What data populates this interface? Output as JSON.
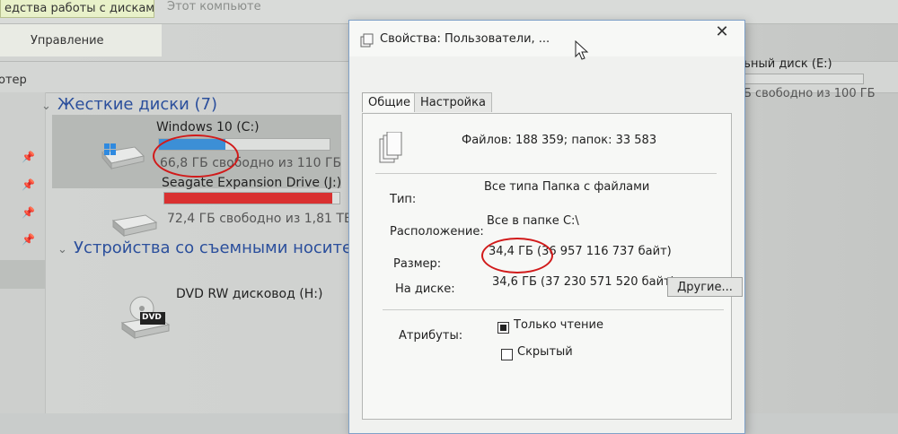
{
  "ribbon": {
    "active_tab": "едства работы с дисками",
    "other_tab": "Этот компьюте",
    "manage_label": "Управление"
  },
  "address": {
    "text": "отер"
  },
  "groups": {
    "hard_drives": "Жесткие диски (7)",
    "removable": "Устройства со съемными носителями"
  },
  "drives": [
    {
      "name": "Windows 10 (C:)",
      "free": "66,8 ГБ свободно из 110 ГБ",
      "used_fraction": 0.39,
      "bar_color": "#3c8fd6"
    },
    {
      "name": "Seagate Expansion Drive (J:)",
      "free": "72,4 ГБ свободно из 1,81 ТБ",
      "used_fraction": 0.96,
      "bar_color": "#d93030"
    },
    {
      "name": "DVD RW дисковод (H:)",
      "icon_text": "DVD"
    }
  ],
  "drive_e": {
    "name": "льный диск (E:)",
    "free": "ГБ свободно из 100 ГБ"
  },
  "dialog": {
    "title": "Свойства: Пользователи, ...",
    "tabs": [
      "Общие",
      "Настройка"
    ],
    "files_summary": "Файлов: 188 359; папок: 33 583",
    "type_label": "Тип:",
    "type_value": "Все типа Папка с файлами",
    "location_label": "Расположение:",
    "location_value": "Все в папке C:\\",
    "size_label": "Размер:",
    "size_value": "34,4 ГБ (36 957 116 737 байт)",
    "disk_label": "На диске:",
    "disk_value": "34,6 ГБ (37 230 571 520 байт)",
    "attributes_label": "Атрибуты:",
    "readonly_label": "Только чтение",
    "hidden_label": "Скрытый",
    "other_button": "Другие..."
  },
  "close_glyph": "✕",
  "colors": {
    "accent_blue": "#3c8fd6",
    "alert_red": "#d93030",
    "annotation_red": "#d11a1a"
  }
}
